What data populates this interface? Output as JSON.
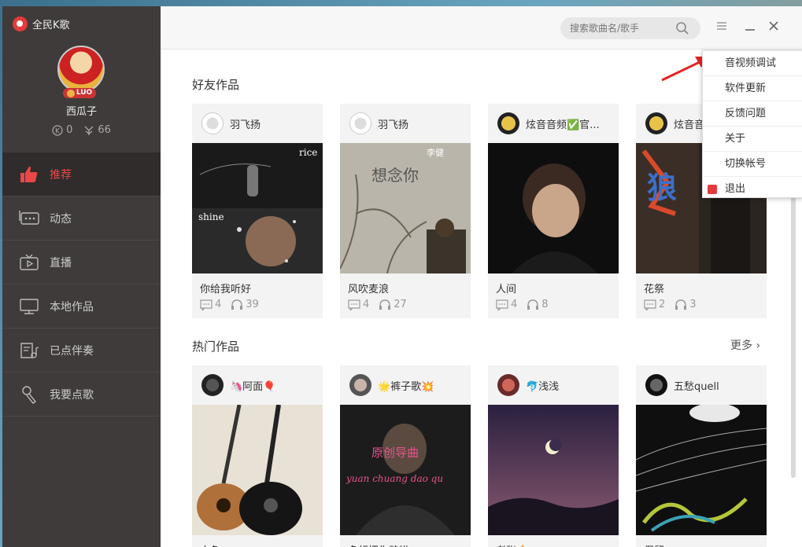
{
  "app": {
    "name": "全民K歌"
  },
  "user": {
    "name": "西瓜子",
    "badge": "LUO",
    "coins": "0",
    "flowers": "66"
  },
  "nav": [
    {
      "label": "推荐",
      "icon": "thumbs-up-icon",
      "active": true
    },
    {
      "label": "动态",
      "icon": "chat-icon"
    },
    {
      "label": "直播",
      "icon": "tv-icon"
    },
    {
      "label": "本地作品",
      "icon": "monitor-icon"
    },
    {
      "label": "已点伴奏",
      "icon": "playlist-icon"
    },
    {
      "label": "我要点歌",
      "icon": "microphone-icon"
    }
  ],
  "search": {
    "placeholder": "搜索歌曲名/歌手"
  },
  "sections": {
    "friends": "好友作品",
    "hot": "热门作品",
    "more": "更多"
  },
  "friend_works": [
    {
      "author": "羽飞扬",
      "title": "你给我听好",
      "comments": "4",
      "plays": "39"
    },
    {
      "author": "羽飞扬",
      "title": "风吹麦浪",
      "comments": "4",
      "plays": "27"
    },
    {
      "author": "炫音音频✅官...",
      "title": "人间",
      "comments": "4",
      "plays": "8"
    },
    {
      "author": "炫音音",
      "title": "花祭",
      "comments": "2",
      "plays": "3"
    }
  ],
  "hot_works": [
    {
      "author": "🦄阿面🎈",
      "title": "木鱼"
    },
    {
      "author": "🌟裤子歌💥",
      "title": "多想把你装进"
    },
    {
      "author": "🐬浅浅",
      "title": "老张🙏"
    },
    {
      "author": "五愁quell",
      "title": "保留"
    }
  ],
  "cover_text": {
    "c1_top": "rice",
    "c1_bottom": "shine",
    "c2": "想念你",
    "c2_artist": "李健",
    "c4": "狼",
    "h2_main": "原创导曲",
    "h2_sub": "yuan chuang dao qu"
  },
  "menu": [
    {
      "label": "音视频调试"
    },
    {
      "label": "软件更新"
    },
    {
      "label": "反馈问题"
    },
    {
      "label": "关于"
    },
    {
      "label": "切换帐号"
    },
    {
      "label": "退出"
    }
  ]
}
